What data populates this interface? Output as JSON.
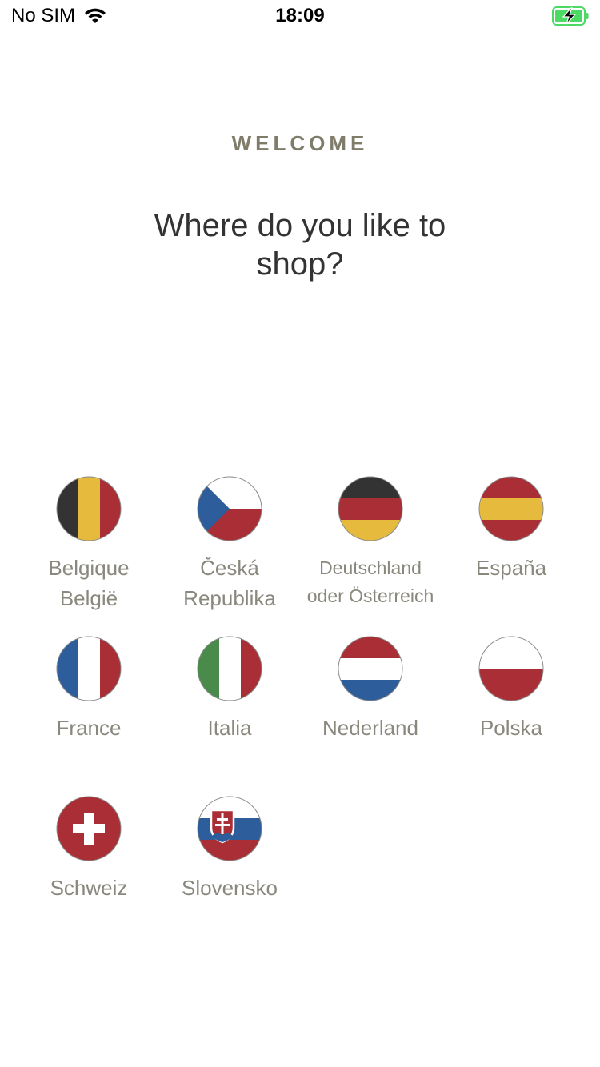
{
  "status_bar": {
    "carrier": "No SIM",
    "time": "18:09",
    "wifi_icon": "wifi-icon",
    "battery_icon": "battery-charging-icon",
    "battery_color": "#4cd964"
  },
  "welcome_label": "WELCOME",
  "headline": "Where do you like to shop?",
  "colors": {
    "accent_text": "#7f7d6a",
    "headline_text": "#333333",
    "label_text": "#8a887d"
  },
  "countries": [
    {
      "label": "Belgique\nBelgië",
      "icon": "belgium-flag-icon"
    },
    {
      "label": "Česká\nRepublika",
      "icon": "czech-flag-icon"
    },
    {
      "label": "Deutschland\noder Österreich",
      "icon": "germany-flag-icon"
    },
    {
      "label": "España",
      "icon": "spain-flag-icon"
    },
    {
      "label": "France",
      "icon": "france-flag-icon"
    },
    {
      "label": "Italia",
      "icon": "italy-flag-icon"
    },
    {
      "label": "Nederland",
      "icon": "netherlands-flag-icon"
    },
    {
      "label": "Polska",
      "icon": "poland-flag-icon"
    },
    {
      "label": "Schweiz",
      "icon": "switzerland-flag-icon"
    },
    {
      "label": "Slovensko",
      "icon": "slovakia-flag-icon"
    }
  ]
}
